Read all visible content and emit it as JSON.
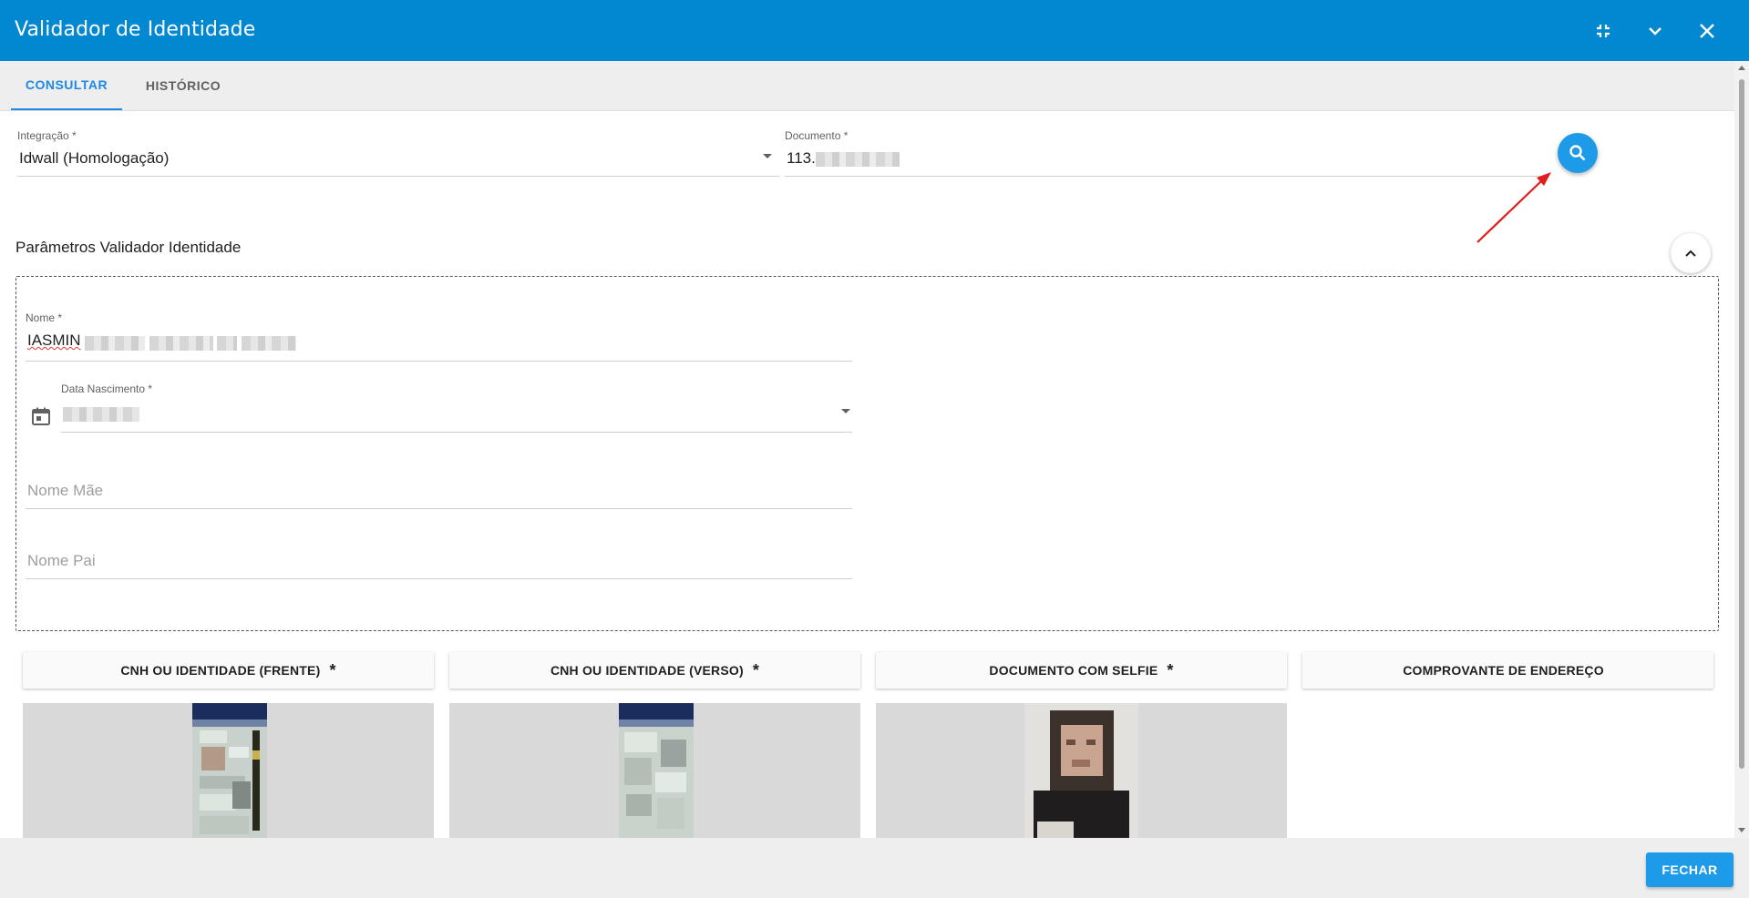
{
  "window": {
    "title": "Validador de Identidade",
    "controls": [
      "collapse-icon",
      "chevron-down-icon",
      "close-icon"
    ]
  },
  "tabs": [
    {
      "label": "CONSULTAR",
      "active": true
    },
    {
      "label": "HISTÓRICO",
      "active": false
    }
  ],
  "form": {
    "integracao": {
      "label": "Integração *",
      "value": "Idwall (Homologação)"
    },
    "documento": {
      "label": "Documento *",
      "value": "113."
    }
  },
  "params": {
    "section_title": "Parâmetros Validador Identidade",
    "nome": {
      "label": "Nome *",
      "value": "IASMIN"
    },
    "data_nascimento": {
      "label": "Data Nascimento *",
      "value": ""
    },
    "nome_mae": {
      "placeholder": "Nome Mãe",
      "value": ""
    },
    "nome_pai": {
      "placeholder": "Nome Pai",
      "value": ""
    }
  },
  "documents": [
    {
      "label": "CNH OU IDENTIDADE (FRENTE)",
      "required": "*"
    },
    {
      "label": "CNH OU IDENTIDADE (VERSO)",
      "required": "*"
    },
    {
      "label": "DOCUMENTO COM SELFIE",
      "required": "*"
    },
    {
      "label": "COMPROVANTE DE ENDEREÇO",
      "required": ""
    }
  ],
  "footer": {
    "close_label": "FECHAR"
  },
  "colors": {
    "header": "#0288d1",
    "accent": "#1e88e5",
    "button": "#1e9be8",
    "annotation_arrow": "#e21b1b"
  }
}
